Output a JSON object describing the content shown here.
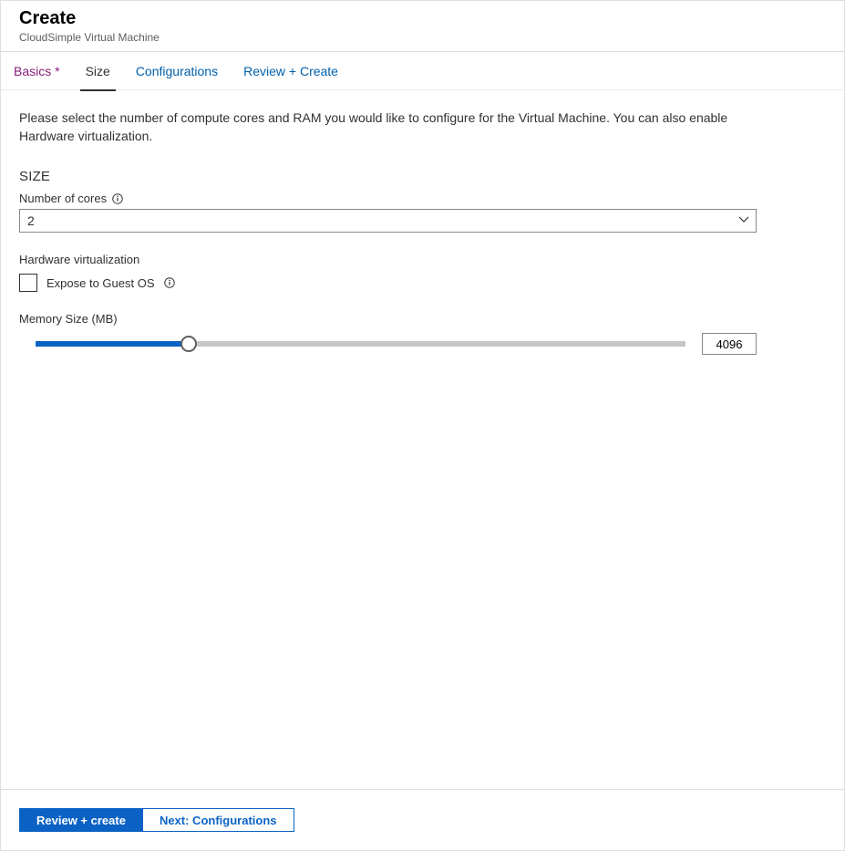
{
  "header": {
    "title": "Create",
    "subtitle": "CloudSimple Virtual Machine"
  },
  "tabs": {
    "items": [
      {
        "label": "Basics *",
        "state": "visited"
      },
      {
        "label": "Size",
        "state": "current"
      },
      {
        "label": "Configurations",
        "state": "link"
      },
      {
        "label": "Review + Create",
        "state": "link"
      }
    ]
  },
  "content": {
    "description": "Please select the number of compute cores and RAM you would like to configure for the Virtual Machine. You can also enable Hardware virtualization.",
    "section_title": "SIZE",
    "cores_label": "Number of cores",
    "cores_value": "2",
    "hw_virt_label": "Hardware virtualization",
    "expose_label": "Expose to Guest OS",
    "expose_checked": false,
    "memory_label": "Memory Size (MB)",
    "memory_value": "4096",
    "memory_percent": 23
  },
  "footer": {
    "review_label": "Review + create",
    "next_label": "Next: Configurations"
  }
}
